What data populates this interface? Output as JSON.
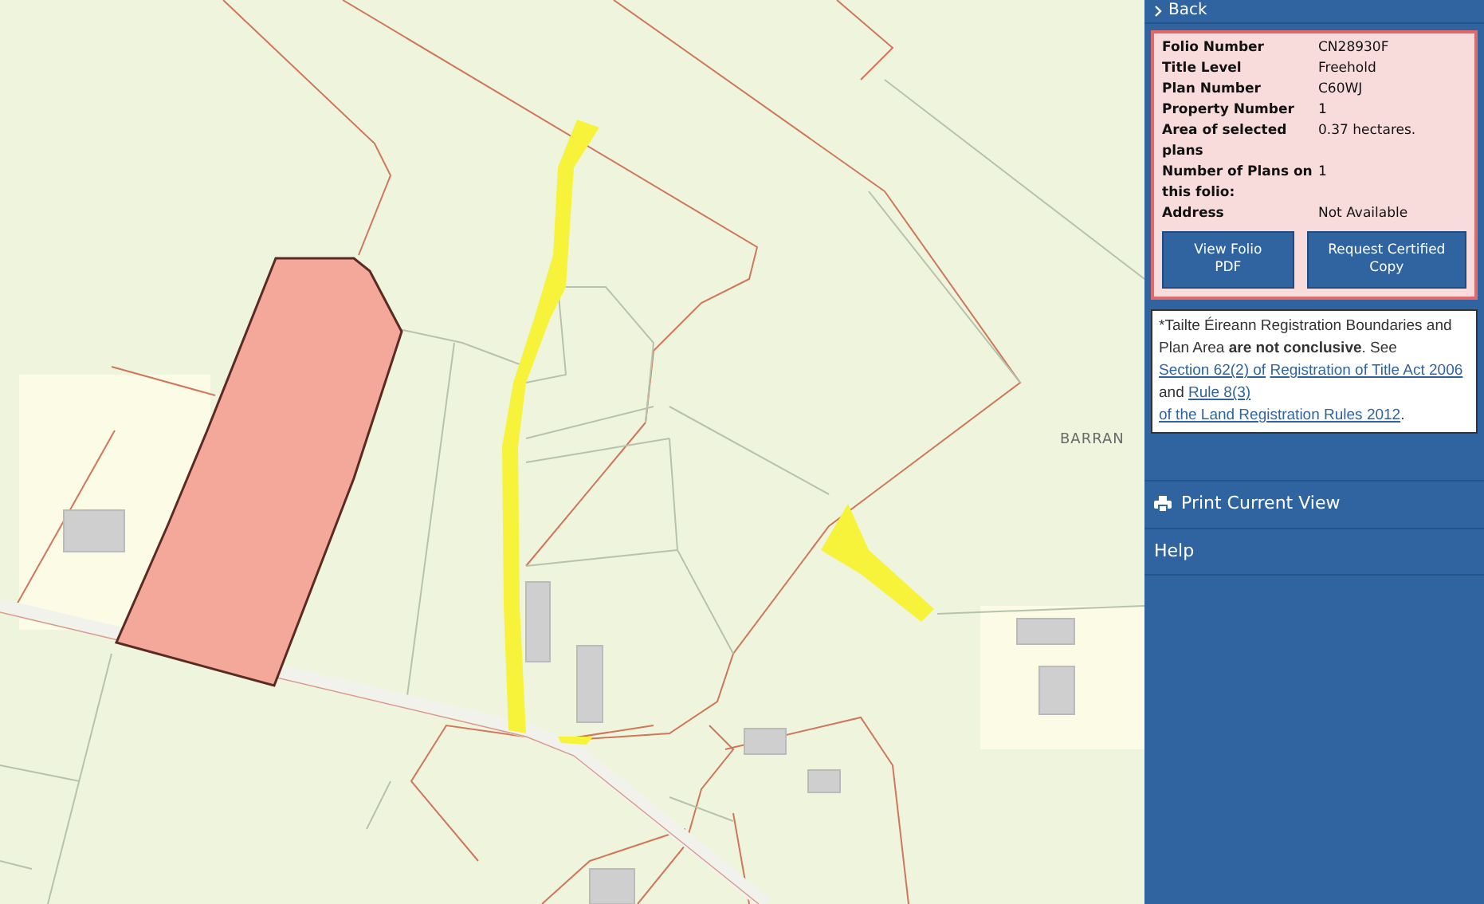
{
  "map": {
    "place_labels": [
      "BARRAN"
    ]
  },
  "sidebar": {
    "back_link": "Back",
    "folio_details": [
      {
        "label": "Folio Number",
        "value": "CN28930F"
      },
      {
        "label": "Title Level",
        "value": "Freehold"
      },
      {
        "label": "Plan Number",
        "value": "C60WJ"
      },
      {
        "label": "Property Number",
        "value": "1"
      },
      {
        "label": "Area of selected plans",
        "value": "0.37 hectares."
      },
      {
        "label": "Number of Plans on this folio:",
        "value": "1"
      },
      {
        "label": "Address",
        "value": "Not Available"
      }
    ],
    "buttons": [
      "View Folio PDF",
      "Request Certified Copy"
    ],
    "note": [
      {
        "kind": "text",
        "text": "*Tailte Éireann Registration Boundaries and Plan Area **are not conclusive**. See "
      },
      {
        "kind": "link",
        "text": "Section 62(2) of"
      },
      {
        "kind": "link",
        "text": "Registration of Title Act 2006"
      },
      {
        "kind": "text",
        "text": " and "
      },
      {
        "kind": "link",
        "text": "Rule 8(3)"
      },
      {
        "kind": "link",
        "text": "of the Land Registration Rules 2012"
      },
      {
        "kind": "text",
        "text": "."
      }
    ],
    "menu": [
      {
        "kind": "print",
        "label": "Print Current View"
      },
      {
        "kind": "plain",
        "label": "Help"
      }
    ]
  }
}
